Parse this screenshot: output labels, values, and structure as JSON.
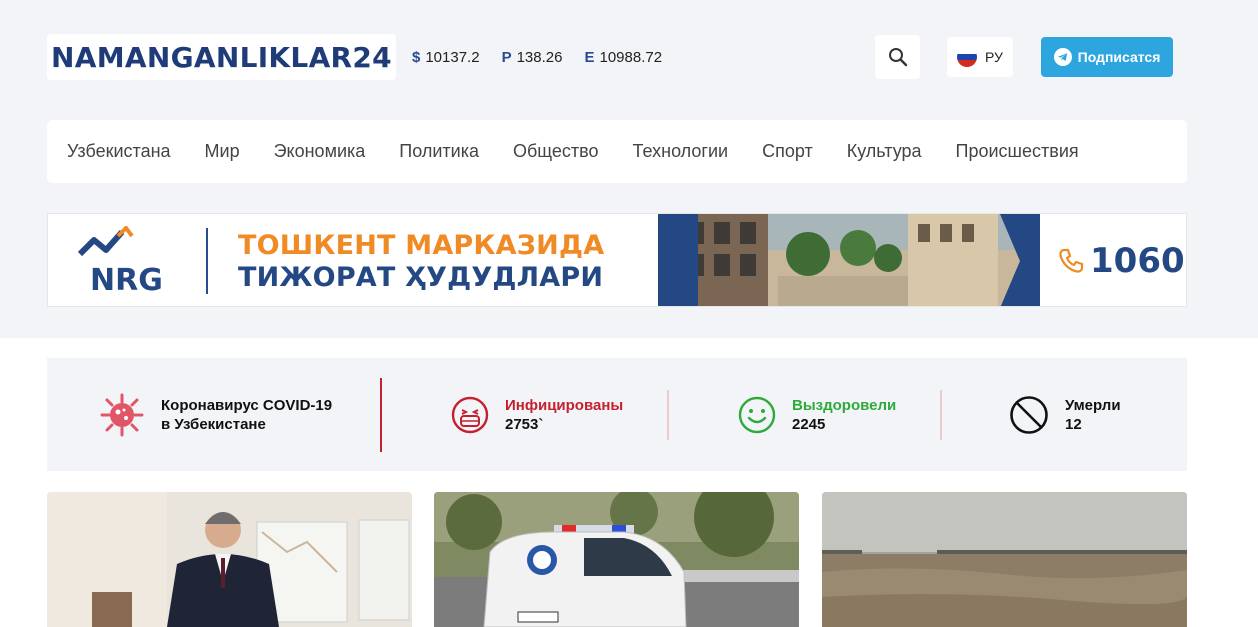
{
  "site": {
    "logo_text": "NAMANGANLIKLAR24"
  },
  "rates": [
    {
      "symbol": "$",
      "value": "10137.2"
    },
    {
      "symbol": "P",
      "value": "138.26"
    },
    {
      "symbol": "E",
      "value": "10988.72"
    }
  ],
  "header": {
    "search_icon": "search-icon",
    "lang_label": "РУ",
    "subscribe_label": "Подписатся",
    "telegram_icon": "telegram-icon"
  },
  "nav": {
    "items": [
      "Узбекистана",
      "Мир",
      "Экономика",
      "Политика",
      "Общество",
      "Технологии",
      "Спорт",
      "Культура",
      "Происшествия"
    ]
  },
  "banner": {
    "brand": "NRG",
    "line1": "ТОШКЕНТ МАРКАЗИДА",
    "line2": "ТИЖОРАТ ҲУДУДЛАРИ",
    "phone": "1060"
  },
  "covid": {
    "title_line1": "Коронавирус COVID-19",
    "title_line2": "в Узбекистане",
    "infected_label": "Инфицированы",
    "infected_value": "2753`",
    "recovered_label": "Выздоровели",
    "recovered_value": "2245",
    "died_label": "Умерли",
    "died_value": "12"
  },
  "colors": {
    "brand_blue": "#1f3c78",
    "telegram": "#2da6df",
    "orange": "#f08a24",
    "red": "#c5202f",
    "green": "#2daa3a"
  }
}
